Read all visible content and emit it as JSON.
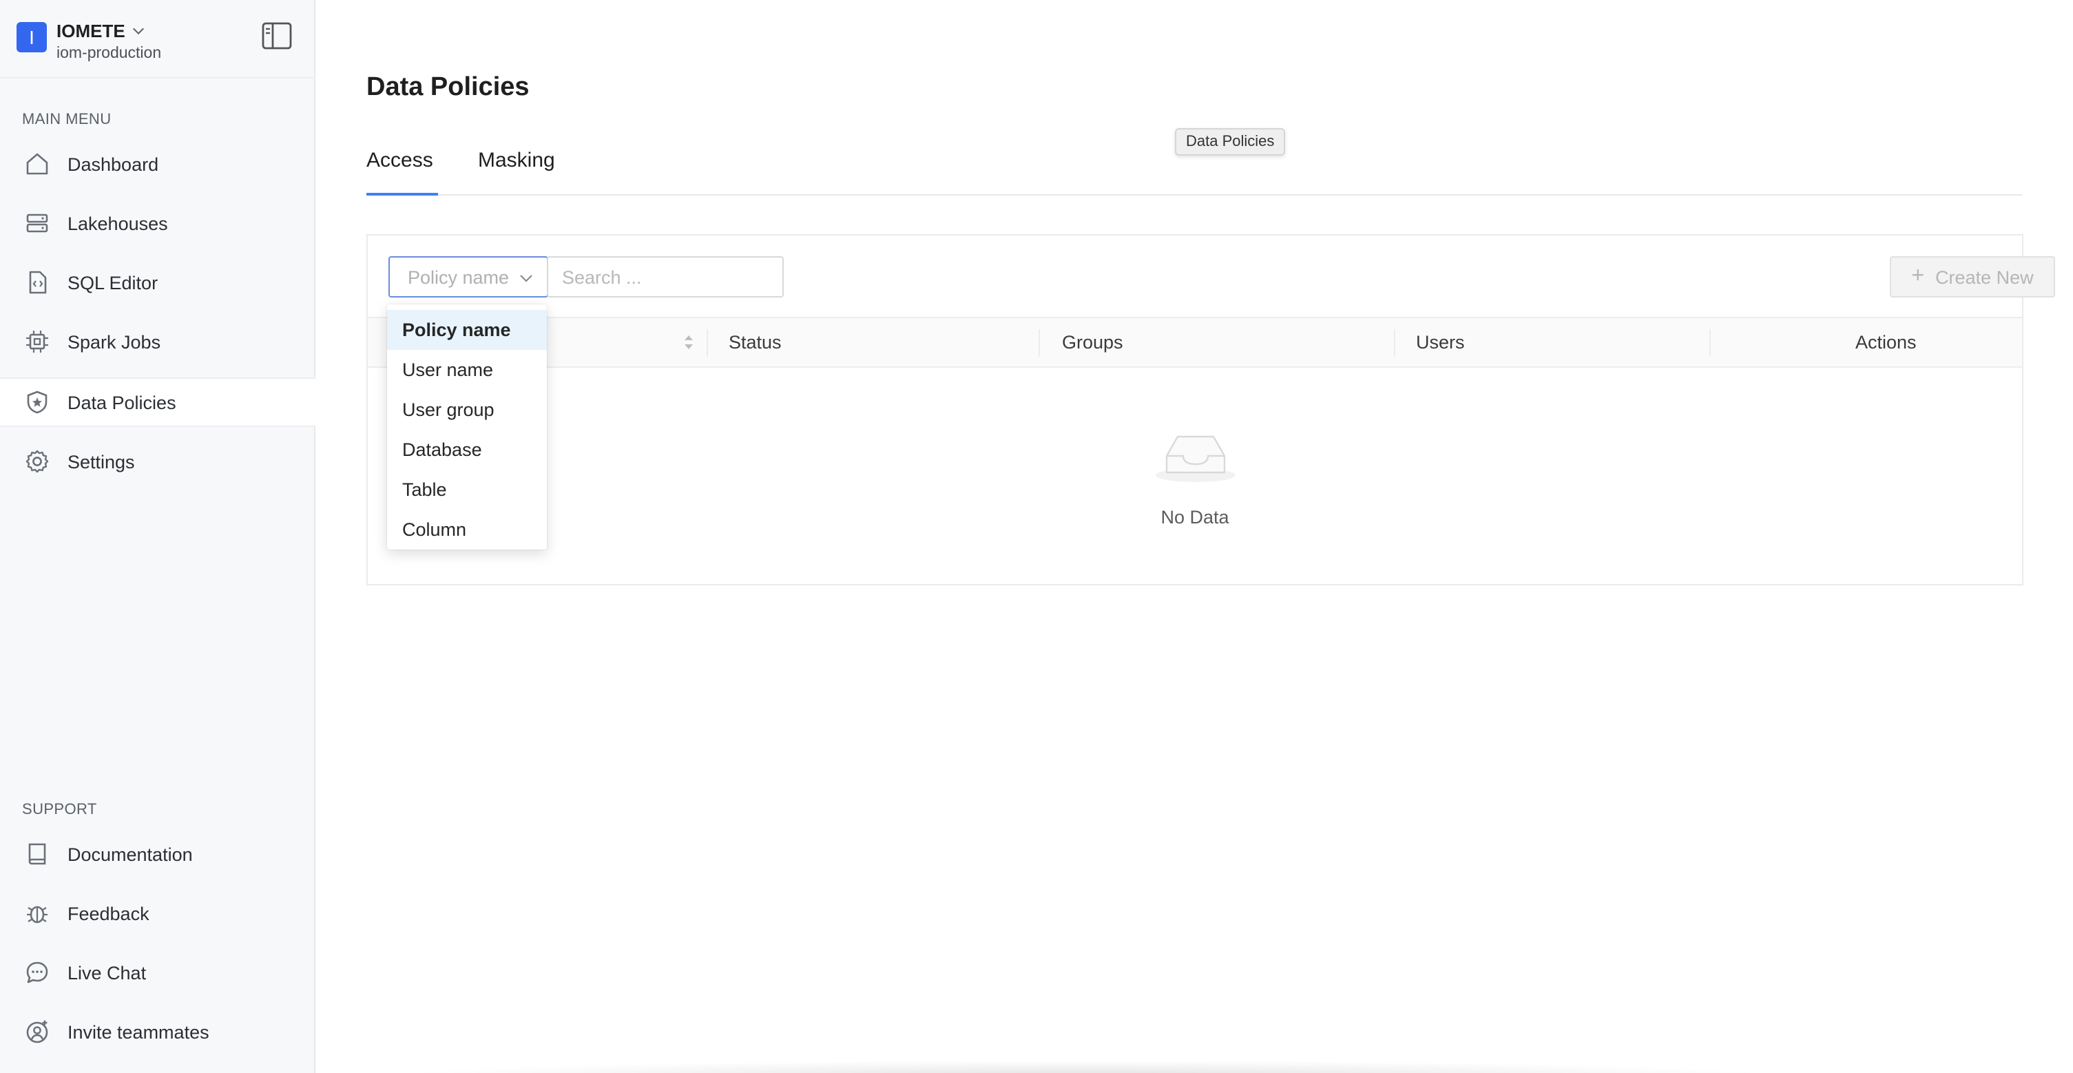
{
  "org": {
    "logo_letter": "I",
    "name": "IOMETE",
    "env": "iom-production"
  },
  "sidebar": {
    "main_menu_label": "MAIN MENU",
    "main_items": [
      {
        "label": "Dashboard",
        "icon": "home-icon"
      },
      {
        "label": "Lakehouses",
        "icon": "server-icon"
      },
      {
        "label": "SQL Editor",
        "icon": "code-file-icon"
      },
      {
        "label": "Spark Jobs",
        "icon": "chip-icon"
      },
      {
        "label": "Data Policies",
        "icon": "shield-star-icon",
        "active": true
      },
      {
        "label": "Settings",
        "icon": "gear-icon"
      }
    ],
    "support_label": "SUPPORT",
    "support_items": [
      {
        "label": "Documentation",
        "icon": "book-icon"
      },
      {
        "label": "Feedback",
        "icon": "bug-icon"
      },
      {
        "label": "Live Chat",
        "icon": "chat-icon"
      },
      {
        "label": "Invite teammates",
        "icon": "user-add-icon"
      }
    ]
  },
  "page": {
    "title": "Data Policies",
    "tooltip": "Data Policies",
    "tabs": [
      {
        "label": "Access",
        "active": true
      },
      {
        "label": "Masking",
        "active": false
      }
    ]
  },
  "toolbar": {
    "filter_selected": "Policy name",
    "search_placeholder": "Search ...",
    "create_label": "Create New"
  },
  "table": {
    "columns": [
      "Status",
      "Groups",
      "Users",
      "Actions"
    ],
    "empty_text": "No Data"
  },
  "dropdown": {
    "options": [
      "Policy name",
      "User name",
      "User group",
      "Database",
      "Table",
      "Column"
    ],
    "selected": "Policy name"
  },
  "colors": {
    "accent": "#3b82f6",
    "brand": "#3467f0"
  }
}
